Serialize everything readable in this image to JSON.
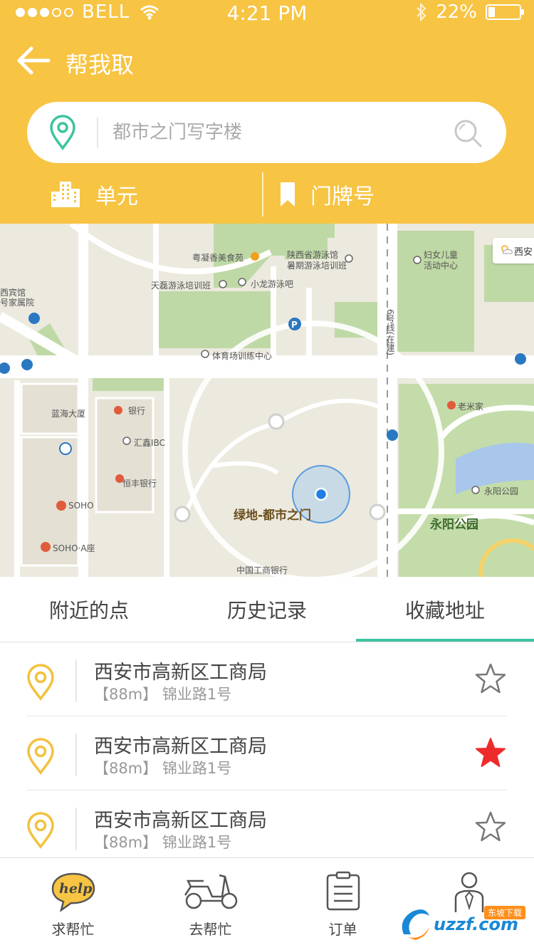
{
  "status_bar": {
    "carrier": "BELL",
    "time": "4:21 PM",
    "battery_text": "22%",
    "battery_level": 0.22
  },
  "nav": {
    "title": "帮我取",
    "back_icon": "arrow-left-icon"
  },
  "search": {
    "placeholder": "都市之门写字楼",
    "pin_icon": "map-pin-icon",
    "search_icon": "search-icon"
  },
  "fields": {
    "unit_label": "单元",
    "door_label": "门牌号"
  },
  "map": {
    "weather_chip": "西安",
    "labels": [
      "粤凝香美食苑",
      "陕西省游泳馆",
      "暑期游泳培训班",
      "妇女儿童",
      "活动中心",
      "天磊游泳培训班",
      "小龙游泳吧",
      "西宾馆",
      "号家属院",
      "6号线(在建)",
      "体育场训练中心",
      "蓝海大厦",
      "银行",
      "老米家",
      "汇鑫IBC",
      "恒丰银行",
      "SOHO",
      "SOHO·A座",
      "中国工商银行",
      "永阳公园"
    ],
    "center_label": "绿地-都市之门",
    "park_label": "永阳公园"
  },
  "tabs": [
    {
      "label": "附近的点",
      "active": false
    },
    {
      "label": "历史记录",
      "active": false
    },
    {
      "label": "收藏地址",
      "active": true
    }
  ],
  "list": [
    {
      "title": "西安市高新区工商局",
      "sub": "【88m】 锦业路1号",
      "starred": false
    },
    {
      "title": "西安市高新区工商局",
      "sub": "【88m】 锦业路1号",
      "starred": true
    },
    {
      "title": "西安市高新区工商局",
      "sub": "【88m】 锦业路1号",
      "starred": false
    }
  ],
  "tabbar": [
    {
      "label": "求帮忙",
      "icon": "help-bubble-icon",
      "icon_text": "help"
    },
    {
      "label": "去帮忙",
      "icon": "scooter-icon"
    },
    {
      "label": "订单",
      "icon": "clipboard-icon"
    },
    {
      "label": "",
      "icon": "profile-icon"
    }
  ],
  "watermark": {
    "text": "uzzf.com",
    "badge": "东坡下载"
  },
  "colors": {
    "header": "#f7c443",
    "accent_green": "#3ec3a0",
    "pin_yellow": "#f2c23e",
    "star_red": "#ee2b2b"
  }
}
